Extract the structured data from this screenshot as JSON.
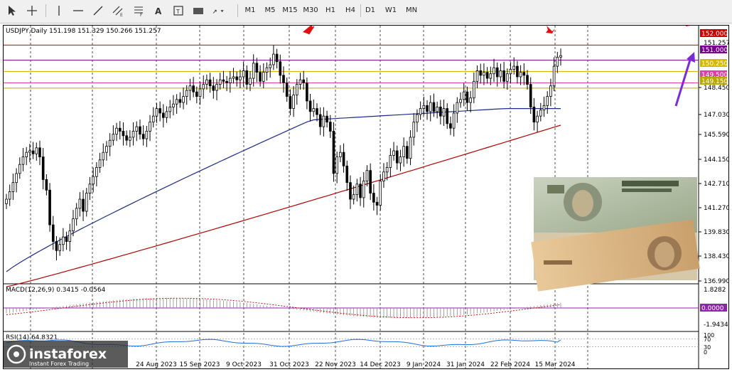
{
  "toolbar": {
    "timeframes": [
      "M1",
      "M5",
      "M15",
      "M30",
      "H1",
      "H4",
      "D1",
      "W1",
      "MN"
    ]
  },
  "chart_data": {
    "type": "candlestick",
    "symbol_info": "USDJPY,Daily  151.198 151.329 150.266 151.257",
    "price_ylim": [
      136.2,
      153.1
    ],
    "price_ticks": [
      "148.450",
      "147.030",
      "145.590",
      "144.150",
      "142.710",
      "141.270",
      "139.830",
      "138.430",
      "136.990"
    ],
    "level_labels": [
      {
        "text": "152.000",
        "price": 152.0,
        "color": "#cc0000"
      },
      {
        "text": "151.000",
        "price": 151.0,
        "color": "#7a0090"
      },
      {
        "text": "150.250",
        "price": 150.25,
        "color": "#d4b800"
      },
      {
        "text": "149.500",
        "price": 149.5,
        "color": "#e040a0"
      },
      {
        "text": "149.150",
        "price": 149.15,
        "color": "#b7a900"
      }
    ],
    "current_price_label": "151.257",
    "x_labels": [
      "24 Aug 2023",
      "15 Sep 2023",
      "9 Oct 2023",
      "31 Oct 2023",
      "22 Nov 2023",
      "14 Dec 2023",
      "9 Jan 2024",
      "31 Jan 2024",
      "22 Feb 2024",
      "15 Mar 2024"
    ],
    "closes": [
      141.8,
      142.3,
      142.9,
      143.5,
      144.1,
      144.6,
      144.9,
      145.0,
      144.8,
      145.2,
      144.6,
      143.1,
      142.4,
      140.1,
      139.0,
      138.4,
      138.8,
      139.3,
      139.0,
      139.7,
      140.5,
      141.2,
      141.8,
      141.0,
      142.2,
      142.8,
      143.3,
      143.9,
      144.4,
      144.9,
      145.3,
      145.7,
      146.1,
      146.5,
      146.3,
      146.0,
      145.7,
      145.9,
      146.3,
      146.6,
      146.1,
      145.8,
      146.3,
      146.9,
      147.3,
      147.8,
      147.5,
      147.2,
      147.6,
      147.9,
      148.1,
      148.4,
      148.2,
      148.6,
      149.0,
      149.3,
      148.9,
      148.6,
      149.1,
      149.4,
      149.7,
      149.3,
      149.0,
      149.4,
      149.7,
      149.6,
      149.5,
      149.8,
      149.9,
      149.7,
      149.9,
      150.3,
      149.4,
      149.8,
      150.8,
      150.2,
      149.6,
      150.2,
      150.5,
      150.7,
      151.4,
      150.9,
      150.0,
      149.5,
      148.6,
      147.8,
      148.7,
      149.4,
      149.7,
      149.5,
      148.3,
      147.6,
      147.8,
      147.4,
      146.6,
      147.3,
      146.9,
      146.3,
      143.5,
      144.6,
      144.9,
      144.0,
      142.9,
      141.8,
      142.1,
      142.8,
      141.9,
      143.0,
      143.7,
      142.2,
      141.6,
      141.4,
      143.0,
      143.6,
      143.9,
      144.7,
      145.0,
      144.2,
      144.6,
      145.3,
      144.5,
      145.9,
      146.9,
      147.4,
      147.8,
      148.0,
      147.6,
      148.2,
      147.6,
      147.9,
      147.3,
      147.8,
      146.8,
      146.5,
      147.5,
      148.2,
      148.4,
      148.9,
      148.2,
      148.5,
      149.6,
      150.3,
      150.0,
      150.2,
      149.8,
      150.1,
      150.5,
      149.9,
      150.3,
      149.6,
      150.1,
      150.4,
      150.6,
      149.9,
      150.2,
      150.0,
      149.4,
      147.9,
      146.9,
      147.3,
      147.7,
      148.0,
      148.6,
      149.3,
      150.6,
      151.2,
      151.3
    ],
    "ma_blue_range": [
      137.0,
      147.8
    ],
    "ma_red_range": [
      136.0,
      146.7
    ],
    "macd": {
      "label": "MACD(12,26,9) 0.3415 -0.0564",
      "axis_labels": [
        "1.8282",
        "0.0000",
        "-1.9434"
      ],
      "ylim": [
        -2.2,
        2.0
      ]
    },
    "rsi": {
      "label": "RSI(14) 64.8321",
      "axis_labels": [
        "100",
        "70",
        "30",
        "0"
      ],
      "value": 64.8
    }
  },
  "watermark": {
    "brand": "instaforex",
    "tagline": "Instant Forex Trading"
  }
}
